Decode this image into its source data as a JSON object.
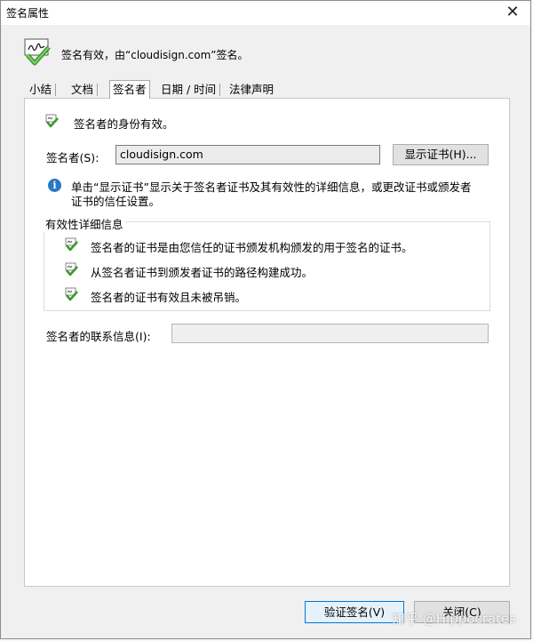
{
  "window": {
    "title": "签名属性",
    "close_symbol": "✕"
  },
  "header": {
    "status_text": "签名有效，由“cloudisign.com”签名。",
    "icon": "signature-valid-icon"
  },
  "tabs": [
    {
      "label": "小结",
      "active": false
    },
    {
      "label": "文档",
      "active": false
    },
    {
      "label": "签名者",
      "active": true
    },
    {
      "label": "日期 / 时间",
      "active": false
    },
    {
      "label": "法律声明",
      "active": false
    }
  ],
  "signer_tab": {
    "identity_status": "签名者的身份有效。",
    "signer_label": "签名者(S):",
    "signer_value": "cloudisign.com",
    "show_cert_button": "显示证书(H)...",
    "info_text_line1": "单击“显示证书”显示关于签名者证书及其有效性的详细信息，或更改证书或颁发者",
    "info_text_line2": "证书的信任设置。",
    "validity_group_title": "有效性详细信息",
    "validity_details": [
      "签名者的证书是由您信任的证书颁发机构颁发的用于签名的证书。",
      "从签名者证书到颁发者证书的路径构建成功。",
      "签名者的证书有效且未被吊销。"
    ],
    "contact_label": "签名者的联系信息(I):",
    "contact_value": ""
  },
  "footer": {
    "verify_button": "验证签名(V)",
    "close_button": "关闭(C)"
  },
  "watermark": "知乎 @Hippocrates",
  "colors": {
    "valid_check": "#3a9a2a",
    "info_blue": "#2b78c5",
    "panel_bg": "#ffffff",
    "dialog_bg": "#f0f0f0"
  }
}
